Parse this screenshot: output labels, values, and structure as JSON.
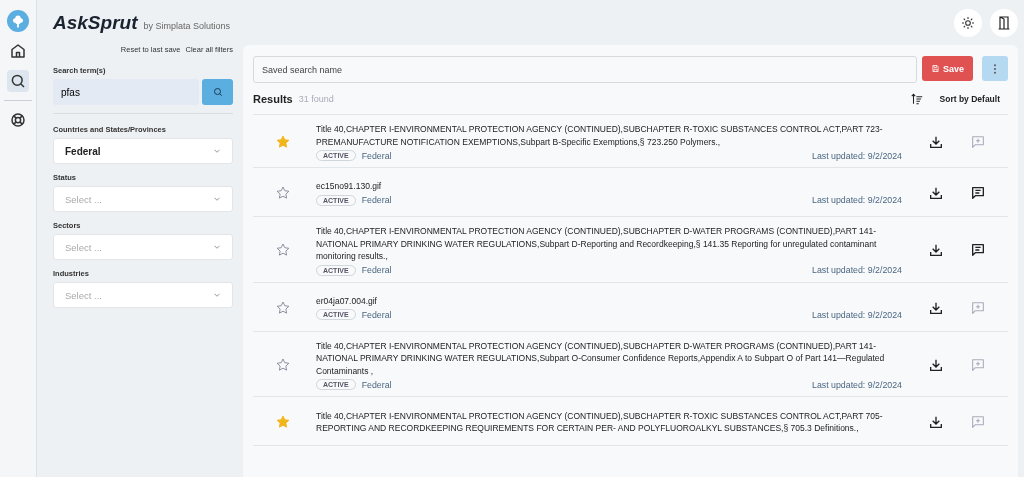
{
  "app": {
    "name": "AskSprut",
    "byline": "by Simplata Solutions"
  },
  "rail": [
    {
      "kind": "home",
      "selected": false
    },
    {
      "kind": "search",
      "selected": true
    },
    {
      "kind": "help",
      "selected": false
    }
  ],
  "filters": {
    "links": [
      "Reset to last save",
      "Clear all filters"
    ],
    "search": {
      "label": "Search term(s)",
      "value": "pfas"
    },
    "selects": [
      {
        "label": "Countries and States/Provinces",
        "value": "Federal"
      },
      {
        "label": "Status",
        "placeholder": "Select ..."
      },
      {
        "label": "Sectors",
        "placeholder": "Select ..."
      },
      {
        "label": "Industries",
        "placeholder": "Select ..."
      }
    ]
  },
  "saved_search": {
    "placeholder": "Saved search name",
    "save_label": "Save"
  },
  "results": {
    "title": "Results",
    "count": "31 found",
    "sort_label": "Sort by Default",
    "rows": [
      {
        "starred": true,
        "title": "Title 40,CHAPTER I-ENVIRONMENTAL PROTECTION AGENCY (CONTINUED),SUBCHAPTER R-TOXIC SUBSTANCES CONTROL ACT,PART 723-PREMANUFACTURE NOTIFICATION EXEMPTIONS,Subpart B-Specific Exemptions,§ 723.250 Polymers.,",
        "status": "ACTIVE",
        "jurisdiction": "Federal",
        "updated": "Last updated: 9/2/2024",
        "has_notes": false
      },
      {
        "starred": false,
        "title": "ec15no91.130.gif",
        "status": "ACTIVE",
        "jurisdiction": "Federal",
        "updated": "Last updated: 9/2/2024",
        "has_notes": true
      },
      {
        "starred": false,
        "title": "Title 40,CHAPTER I-ENVIRONMENTAL PROTECTION AGENCY (CONTINUED),SUBCHAPTER D-WATER PROGRAMS (CONTINUED),PART 141-NATIONAL PRIMARY DRINKING WATER REGULATIONS,Subpart D-Reporting and Recordkeeping,§ 141.35 Reporting for unregulated contaminant monitoring results.,",
        "status": "ACTIVE",
        "jurisdiction": "Federal",
        "updated": "Last updated: 9/2/2024",
        "has_notes": true
      },
      {
        "starred": false,
        "title": "er04ja07.004.gif",
        "status": "ACTIVE",
        "jurisdiction": "Federal",
        "updated": "Last updated: 9/2/2024",
        "has_notes": false
      },
      {
        "starred": false,
        "title": "Title 40,CHAPTER I-ENVIRONMENTAL PROTECTION AGENCY (CONTINUED),SUBCHAPTER D-WATER PROGRAMS (CONTINUED),PART 141-NATIONAL PRIMARY DRINKING WATER REGULATIONS,Subpart O-Consumer Confidence Reports,Appendix A to Subpart O of Part 141—Regulated Contaminants ,",
        "status": "ACTIVE",
        "jurisdiction": "Federal",
        "updated": "Last updated: 9/2/2024",
        "has_notes": false
      },
      {
        "starred": true,
        "title": "Title 40,CHAPTER I-ENVIRONMENTAL PROTECTION AGENCY (CONTINUED),SUBCHAPTER R-TOXIC SUBSTANCES CONTROL ACT,PART 705-REPORTING AND RECORDKEEPING REQUIREMENTS FOR CERTAIN PER- AND POLYFLUOROALKYL SUBSTANCES,§ 705.3 Definitions.,",
        "has_notes": false
      }
    ]
  }
}
